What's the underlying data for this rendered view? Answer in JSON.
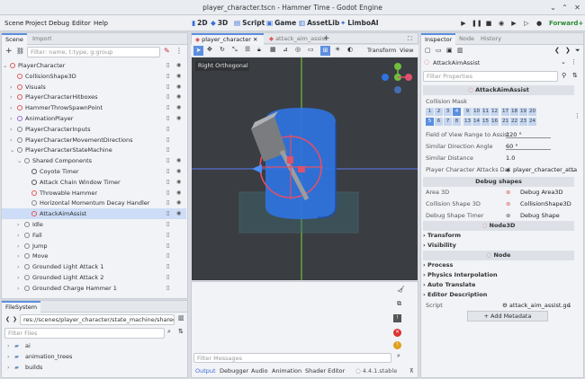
{
  "window": {
    "title": "player_character.tscn - Hammer Time - Godot Engine"
  },
  "menu": [
    "Scene",
    "Project",
    "Debug",
    "Editor",
    "Help"
  ],
  "workspaces": [
    "2D",
    "3D",
    "Script",
    "Game",
    "AssetLib",
    "LimboAI"
  ],
  "renderer": "Forward+",
  "scene_dock": {
    "tabs": [
      "Scene",
      "Import"
    ],
    "filter_placeholder": "Filter: name, t:type, g:group",
    "nodes": [
      {
        "label": "PlayerCharacter",
        "depth": 0,
        "color": "#e05a5a"
      },
      {
        "label": "CollisionShape3D",
        "depth": 1,
        "color": "#e05a5a"
      },
      {
        "label": "Visuals",
        "depth": 1,
        "color": "#e05a5a"
      },
      {
        "label": "PlayerCharacterHitboxes",
        "depth": 1,
        "color": "#e05a5a"
      },
      {
        "label": "HammerThrowSpawnPoint",
        "depth": 1,
        "color": "#e05a5a"
      },
      {
        "label": "AnimationPlayer",
        "depth": 1,
        "color": "#9b6bd6"
      },
      {
        "label": "PlayerCharacterInputs",
        "depth": 1,
        "color": "#888888"
      },
      {
        "label": "PlayerCharacterMovementDirections",
        "depth": 1,
        "color": "#888888"
      },
      {
        "label": "PlayerCharacterStateMachine",
        "depth": 1,
        "color": "#888888"
      },
      {
        "label": "Shared Components",
        "depth": 2,
        "color": "#888888"
      },
      {
        "label": "Coyote Timer",
        "depth": 3,
        "color": "#555555"
      },
      {
        "label": "Attack Chain Window Timer",
        "depth": 3,
        "color": "#555555"
      },
      {
        "label": "Throwable Hammer",
        "depth": 3,
        "color": "#e05a5a"
      },
      {
        "label": "Horizontal Momentum Decay Handler",
        "depth": 3,
        "color": "#888888"
      },
      {
        "label": "AttackAimAssist",
        "depth": 3,
        "color": "#e05a5a"
      },
      {
        "label": "Idle",
        "depth": 2,
        "color": "#888888"
      },
      {
        "label": "Fall",
        "depth": 2,
        "color": "#888888"
      },
      {
        "label": "Jump",
        "depth": 2,
        "color": "#888888"
      },
      {
        "label": "Move",
        "depth": 2,
        "color": "#888888"
      },
      {
        "label": "Grounded Light Attack 1",
        "depth": 2,
        "color": "#888888"
      },
      {
        "label": "Grounded Light Attack 2",
        "depth": 2,
        "color": "#888888"
      },
      {
        "label": "Grounded Charge Hammer 1",
        "depth": 2,
        "color": "#888888"
      }
    ]
  },
  "filesystem": {
    "tab": "FileSystem",
    "path": "res://scenes/player_character/state_machine/shared_comp",
    "filter_placeholder": "Filter Files",
    "items": [
      "ai",
      "animation_trees",
      "builds"
    ]
  },
  "editor_tabs": [
    "player_character",
    "attack_aim_assist"
  ],
  "viewport": {
    "label": "Right Orthogonal",
    "toolbar_transform": "Transform",
    "toolbar_view": "View"
  },
  "bottom": {
    "filter_placeholder": "Filter Messages",
    "tabs": [
      "Output",
      "Debugger",
      "Audio",
      "Animation",
      "Shader Editor"
    ],
    "version": "4.4.1.stable"
  },
  "inspector": {
    "tabs": [
      "Inspector",
      "Node",
      "History"
    ],
    "node": "AttackAimAssist",
    "filter_placeholder": "Filter Properties",
    "header": "AttackAimAssist",
    "collision_mask_label": "Collision Mask",
    "mask_row1": [
      "1",
      "2",
      "3",
      "4",
      "9",
      "10",
      "11",
      "12",
      "17",
      "18",
      "19",
      "20"
    ],
    "mask_row2": [
      "5",
      "6",
      "7",
      "8",
      "13",
      "14",
      "15",
      "16",
      "21",
      "22",
      "23",
      "24"
    ],
    "props": [
      {
        "k": "Field of View Range to Assist",
        "v": "120 °"
      },
      {
        "k": "Similar Direction Angle",
        "v": "60 °"
      },
      {
        "k": "Similar Distance",
        "v": "1.0"
      },
      {
        "k": "Player Character Attacks Dat",
        "v": "player_character_atta"
      }
    ],
    "debug_header": "Debug shapes",
    "debug": [
      {
        "k": "Area 3D",
        "v": "Debug Area3D"
      },
      {
        "k": "Collision Shape 3D",
        "v": "CollisionShape3D"
      },
      {
        "k": "Debug Shape Timer",
        "v": "Debug Shape Timer"
      }
    ],
    "node3d_header": "Node3D",
    "node3d_groups": [
      "Transform",
      "Visibility"
    ],
    "node_header": "Node",
    "node_groups": [
      "Process",
      "Physics Interpolation",
      "Auto Translate",
      "Editor Description"
    ],
    "script_label": "Script",
    "script_value": "attack_aim_assist.gd",
    "add_metadata": "Add Metadata"
  }
}
